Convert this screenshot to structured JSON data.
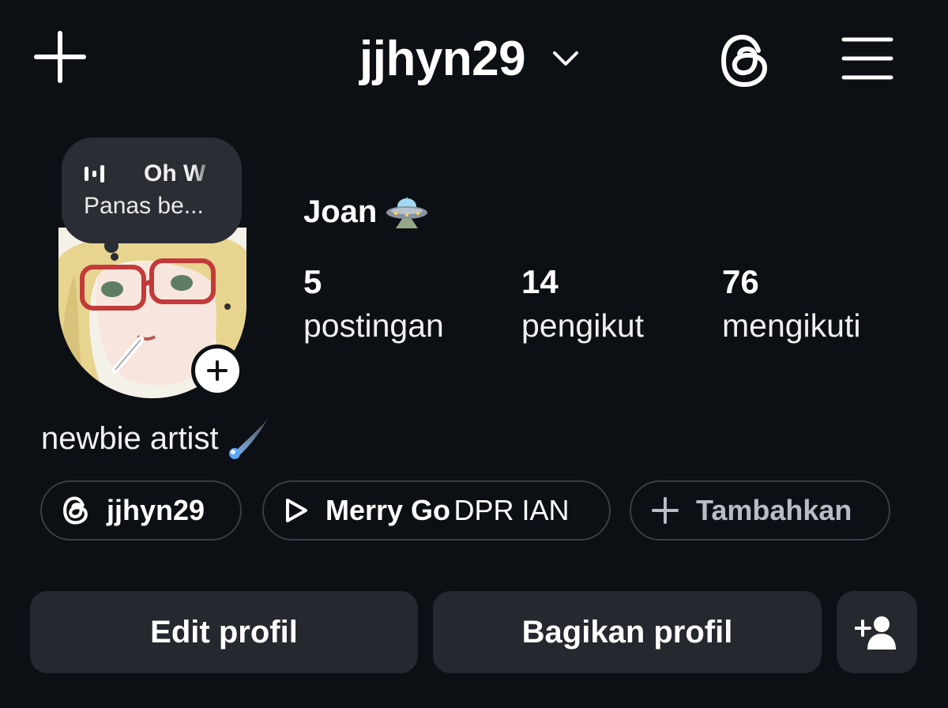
{
  "header": {
    "username": "jjhyn29",
    "icons": {
      "new": "plus-icon",
      "switch": "chevron-down-icon",
      "threads": "threads-icon",
      "menu": "hamburger-menu-icon"
    }
  },
  "note": {
    "music_icon": "audio-wave-icon",
    "song_title": "Oh W",
    "text": "Panas be..."
  },
  "profile": {
    "display_name": "Joan",
    "display_name_emoji": "ufo-emoji",
    "stats": [
      {
        "value": "5",
        "label": "postingan"
      },
      {
        "value": "14",
        "label": "pengikut"
      },
      {
        "value": "76",
        "label": "mengikuti"
      }
    ],
    "bio": "newbie artist",
    "bio_emoji": "comet-emoji"
  },
  "chips": {
    "threads_handle": "jjhyn29",
    "music_title": "Merry Go",
    "music_artist": "DPR IAN",
    "add_label": "Tambahkan"
  },
  "actions": {
    "edit_label": "Edit profil",
    "share_label": "Bagikan profil",
    "add_user_icon": "add-person-icon"
  },
  "colors": {
    "background": "#0c0f14",
    "button": "#25282e",
    "note": "#2a2d33",
    "chip_border": "#3a3d43"
  }
}
